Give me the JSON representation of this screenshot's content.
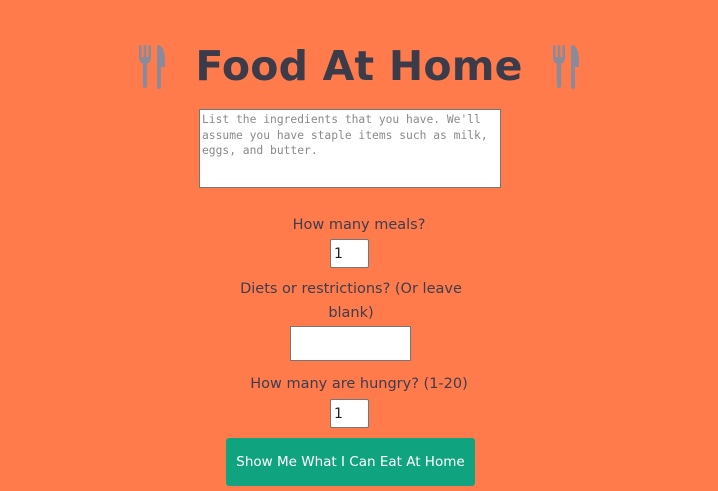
{
  "header": {
    "title": "Food At Home",
    "left_icon": "fork-knife-icon",
    "right_icon": "fork-knife-icon",
    "icon_color": "#8a8a9a"
  },
  "ingredients": {
    "value": "",
    "placeholder": "List the ingredients that you have. We'll assume you have staple items such as milk, eggs, and butter."
  },
  "meals": {
    "label": "How many meals?",
    "value": "1"
  },
  "diets": {
    "label": "Diets or restrictions? (Or leave blank)",
    "value": ""
  },
  "hungry": {
    "label": "How many are hungry? (1-20)",
    "value": "1"
  },
  "submit": {
    "label": "Show Me What I Can Eat At Home"
  },
  "colors": {
    "background": "#ff7b4c",
    "button": "#10a37f",
    "text": "#3d3d4e"
  }
}
